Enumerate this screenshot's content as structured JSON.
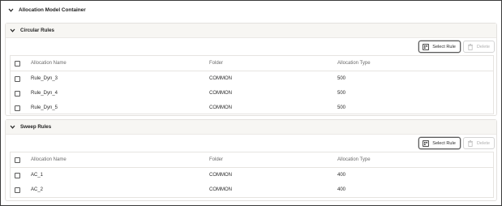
{
  "container": {
    "title": "Allocation Model Container"
  },
  "sections": [
    {
      "title": "Circular Rules",
      "select_label": "Select Rule",
      "delete_label": "Delete",
      "columns": [
        "Allocation Name",
        "Folder",
        "Allocation Type"
      ],
      "rows": [
        [
          "Rule_Dyn_3",
          "COMMON",
          "500"
        ],
        [
          "Rule_Dyn_4",
          "COMMON",
          "500"
        ],
        [
          "Rule_Dyn_5",
          "COMMON",
          "500"
        ]
      ]
    },
    {
      "title": "Sweep Rules",
      "select_label": "Select Rule",
      "delete_label": "Delete",
      "columns": [
        "Allocation Name",
        "Folder",
        "Allocation Type"
      ],
      "rows": [
        [
          "AC_1",
          "COMMON",
          "400"
        ],
        [
          "AC_2",
          "COMMON",
          "400"
        ]
      ]
    }
  ],
  "icons": {
    "collapse": "chevron-down-icon",
    "select_rule": "select-rule-icon",
    "delete": "trash-icon"
  },
  "colors": {
    "section_header_bg": "#f7f6f3",
    "border": "#e3e1de",
    "disabled_text": "#b0b0b0"
  }
}
